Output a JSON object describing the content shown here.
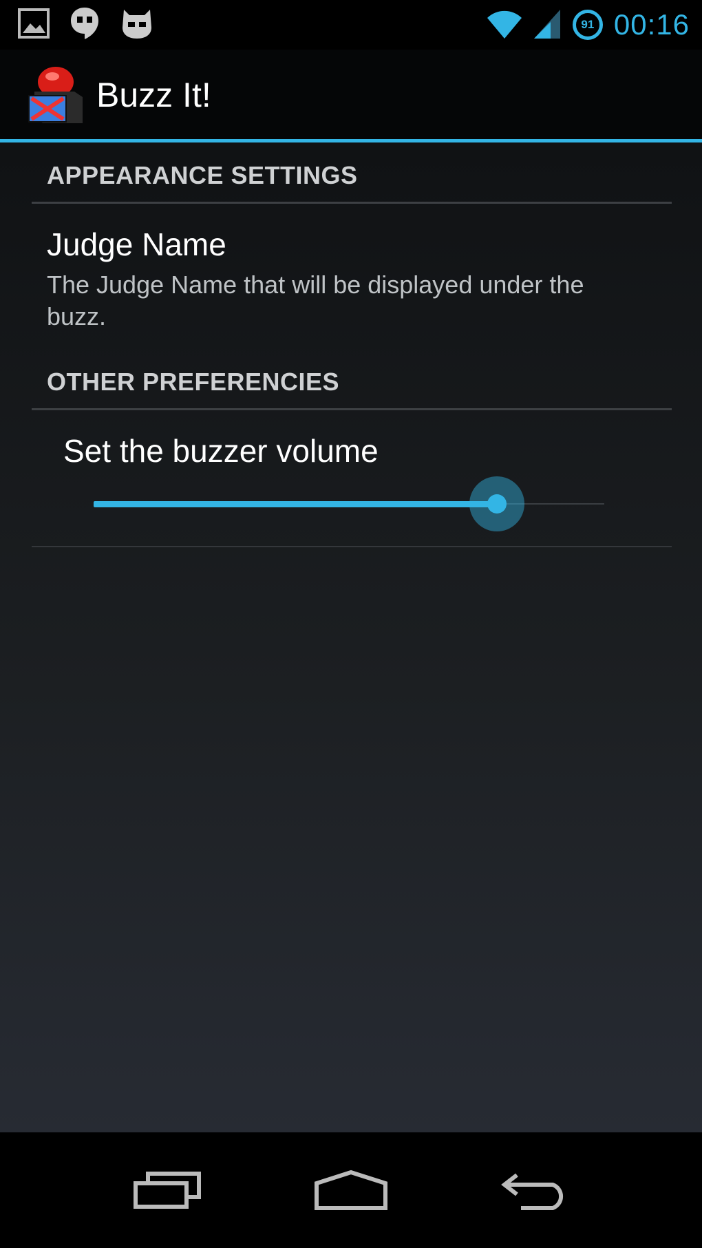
{
  "status_bar": {
    "clock": "00:16",
    "battery_level": "91",
    "icons": [
      "image-icon",
      "hangouts-icon",
      "cyanogen-icon",
      "wifi-icon",
      "signal-icon"
    ]
  },
  "action_bar": {
    "title": "Buzz It!",
    "app_icon": "buzzer-icon"
  },
  "sections": [
    {
      "header": "APPEARANCE SETTINGS",
      "items": [
        {
          "title": "Judge Name",
          "summary": "The Judge Name that will be displayed under the buzz."
        }
      ]
    },
    {
      "header": "OTHER PREFERENCIES",
      "items": [
        {
          "title": "Set the buzzer volume",
          "slider_value_fraction": 0.79
        }
      ]
    }
  ],
  "nav_bar": {
    "buttons": [
      "recent-apps-icon",
      "home-icon",
      "back-icon"
    ]
  },
  "colors": {
    "accent": "#33b5e5"
  }
}
